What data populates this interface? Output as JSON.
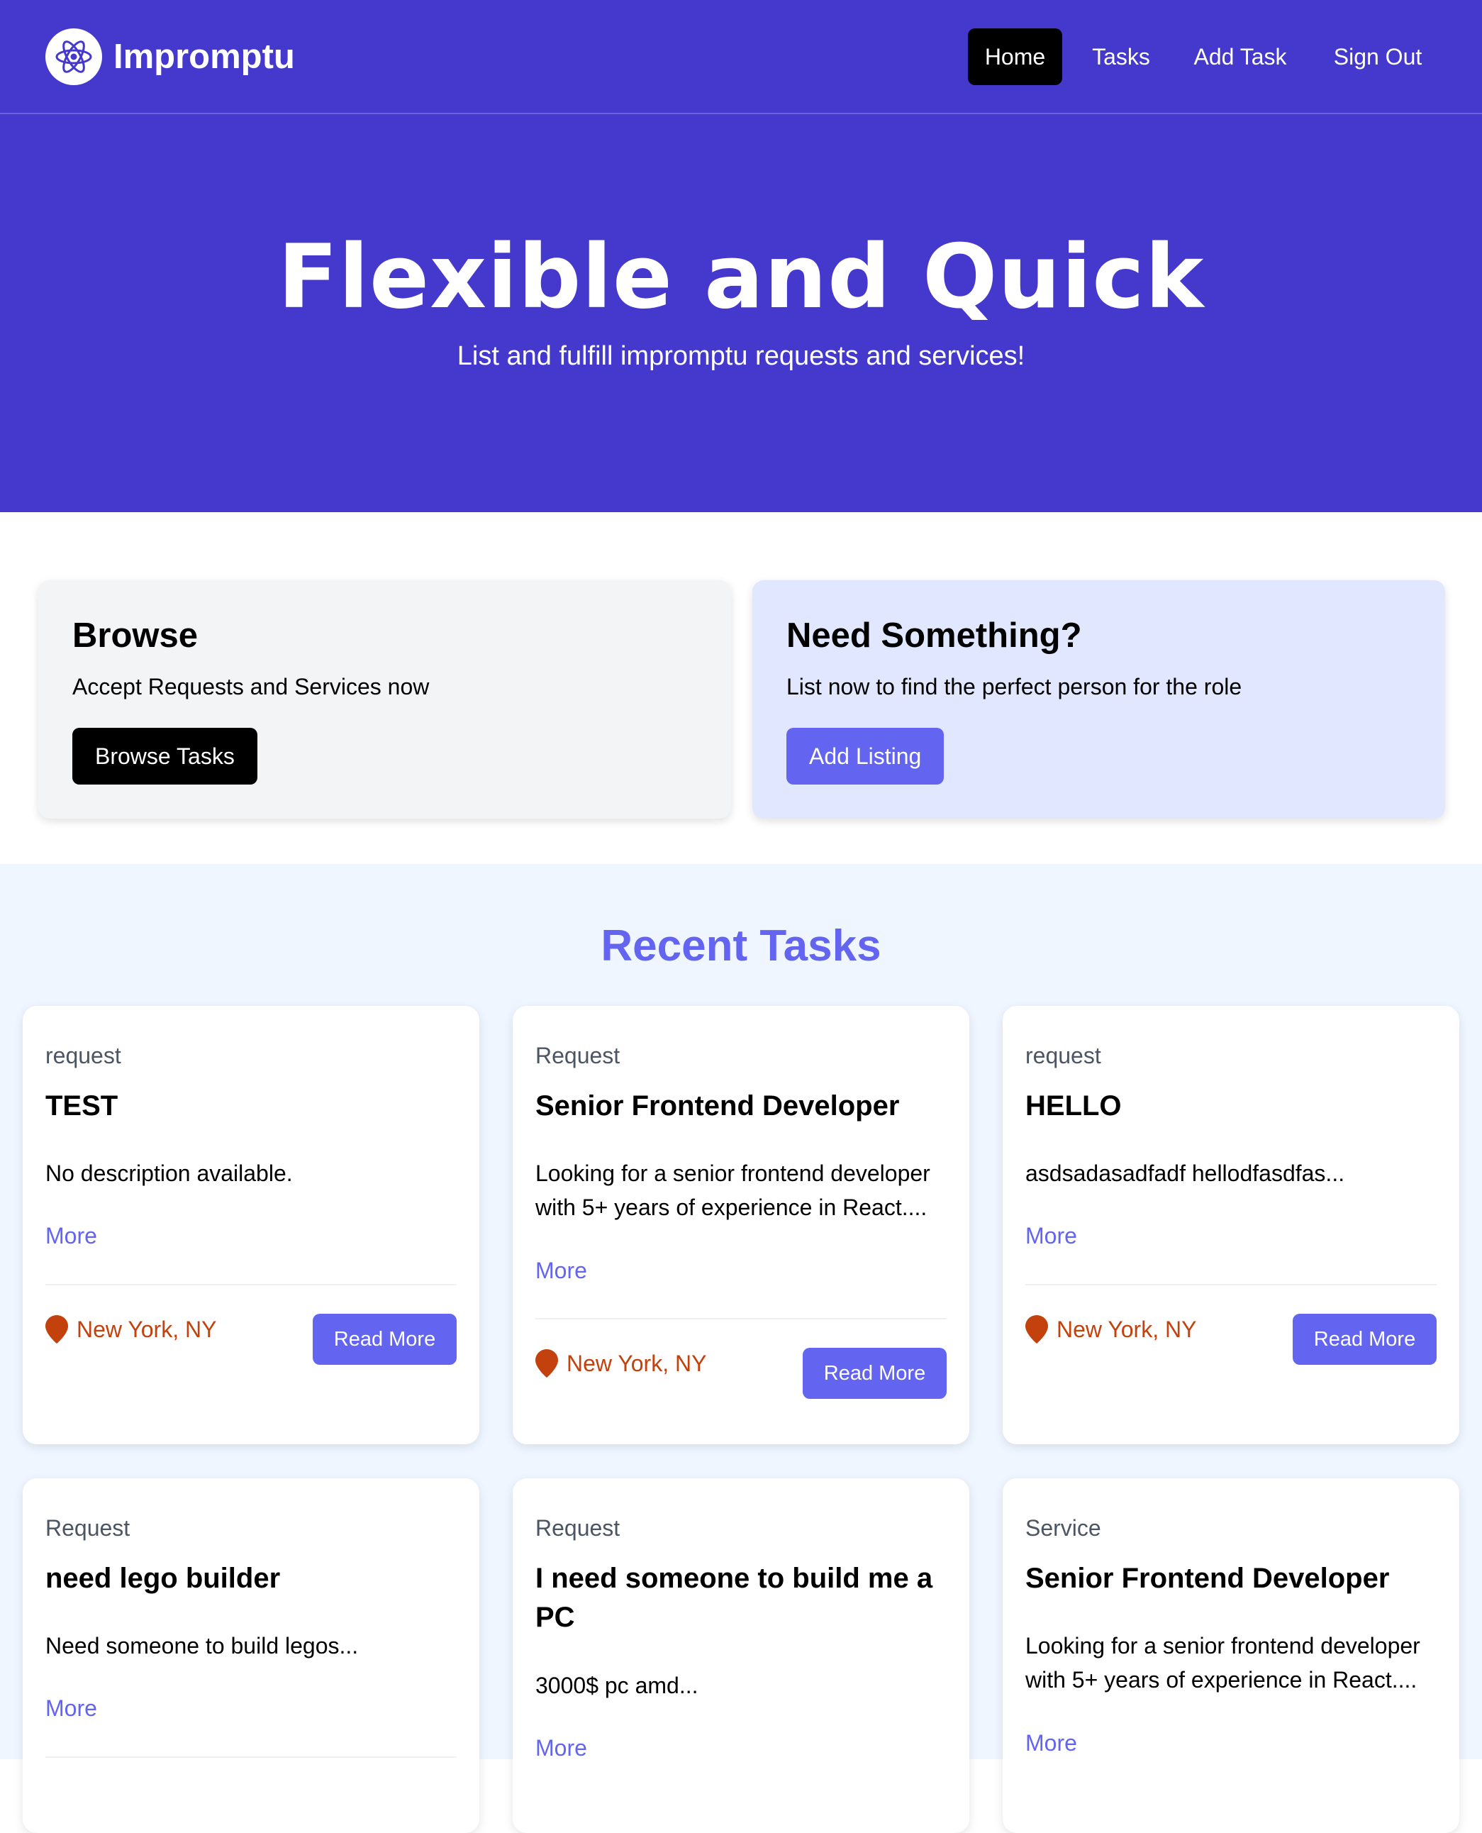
{
  "brand": {
    "name": "Impromptu",
    "logo_icon": "atom-icon"
  },
  "nav": {
    "home": "Home",
    "tasks": "Tasks",
    "add_task": "Add Task",
    "sign_out": "Sign Out"
  },
  "hero": {
    "title": "Flexible and Quick",
    "subtitle": "List and fulfill impromptu requests and services!"
  },
  "browse": {
    "title": "Browse",
    "text": "Accept Requests and Services now",
    "button": "Browse Tasks"
  },
  "need": {
    "title": "Need Something?",
    "text": "List now to find the perfect person for the role",
    "button": "Add Listing"
  },
  "recent": {
    "title": "Recent Tasks",
    "cards": [
      {
        "type": "request",
        "title": "TEST",
        "desc": "No description available.",
        "more": "More",
        "location": "New York, NY",
        "button": "Read More"
      },
      {
        "type": "Request",
        "title": "Senior Frontend Developer",
        "desc": "Looking for a senior frontend developer with 5+ years of experience in React....",
        "more": "More",
        "location": "New York, NY",
        "button": "Read More"
      },
      {
        "type": "request",
        "title": "HELLO",
        "desc": "asdsadasadfadf hellodfasdfas...",
        "more": "More",
        "location": "New York, NY",
        "button": "Read More"
      },
      {
        "type": "Request",
        "title": "need lego builder",
        "desc": "Need someone to build legos...",
        "more": "More"
      },
      {
        "type": "Request",
        "title": "I need someone to build me a PC",
        "desc": "3000$ pc amd...",
        "more": "More"
      },
      {
        "type": "Service",
        "title": "Senior Frontend Developer",
        "desc": "Looking for a senior frontend developer with 5+ years of experience in React....",
        "more": "More"
      }
    ]
  },
  "colors": {
    "brand": "#4539cd",
    "accent": "#6365f1",
    "location": "#c2410c"
  }
}
